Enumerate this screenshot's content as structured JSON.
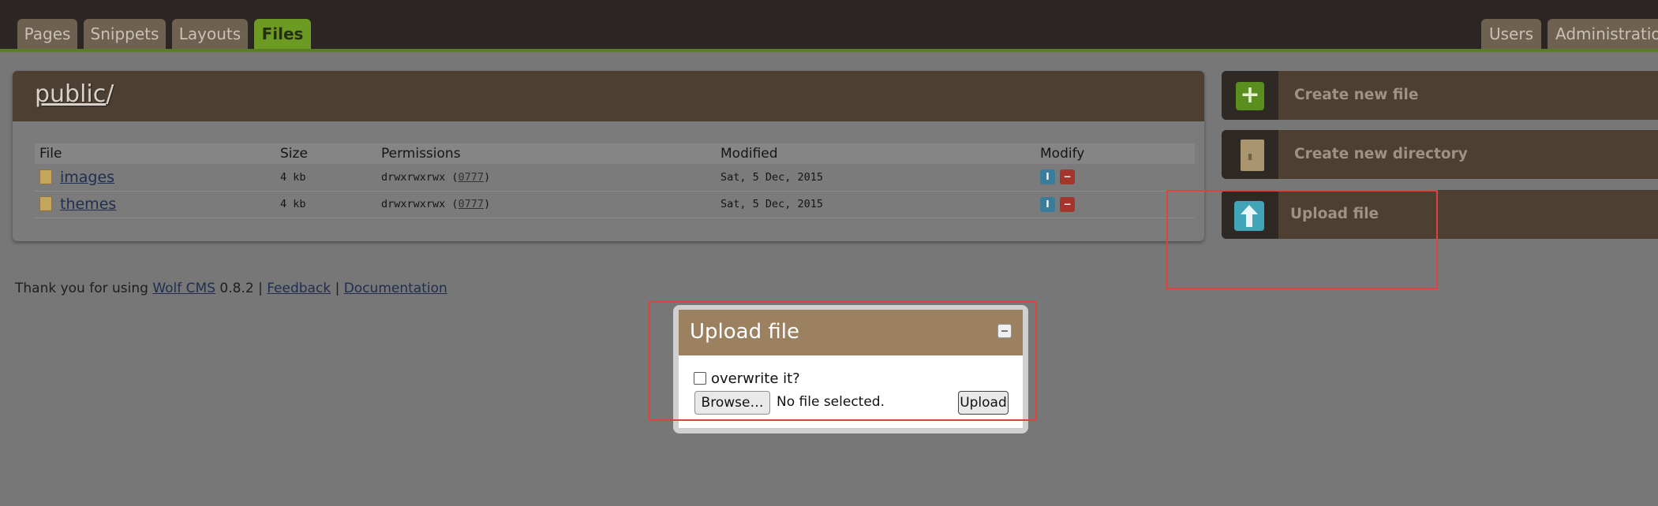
{
  "nav": {
    "tabs_left": [
      "Pages",
      "Snippets",
      "Layouts",
      "Files"
    ],
    "active_tab": "Files",
    "tabs_right": [
      "Users",
      "Administration"
    ]
  },
  "panel": {
    "title_link": "public",
    "title_suffix": "/",
    "columns": [
      "File",
      "Size",
      "Permissions",
      "Modified",
      "Modify"
    ],
    "rows": [
      {
        "name": "images",
        "size": "4 kb",
        "perm_text": "drwxrwxrwx (",
        "perm_octal": "0777",
        "perm_close": ")",
        "modified": "Sat, 5 Dec, 2015"
      },
      {
        "name": "themes",
        "size": "4 kb",
        "perm_text": "drwxrwxrwx (",
        "perm_octal": "0777",
        "perm_close": ")",
        "modified": "Sat, 5 Dec, 2015"
      }
    ]
  },
  "footer": {
    "prefix": "Thank you for using ",
    "cms_link": "Wolf CMS",
    "version": " 0.8.2 | ",
    "feedback": "Feedback",
    "sep": " | ",
    "docs": "Documentation"
  },
  "actions": {
    "create_file": "Create new file",
    "create_dir": "Create new directory",
    "upload": "Upload file"
  },
  "dialog": {
    "title": "Upload file",
    "overwrite_label": "overwrite it?",
    "browse_label": "Browse…",
    "no_file": "No file selected.",
    "upload_button": "Upload"
  },
  "colors": {
    "accent_green": "#6c9a22",
    "panel_brown": "#4d3f31",
    "dialog_header": "#9b8160",
    "highlight_red": "#e0433f"
  }
}
